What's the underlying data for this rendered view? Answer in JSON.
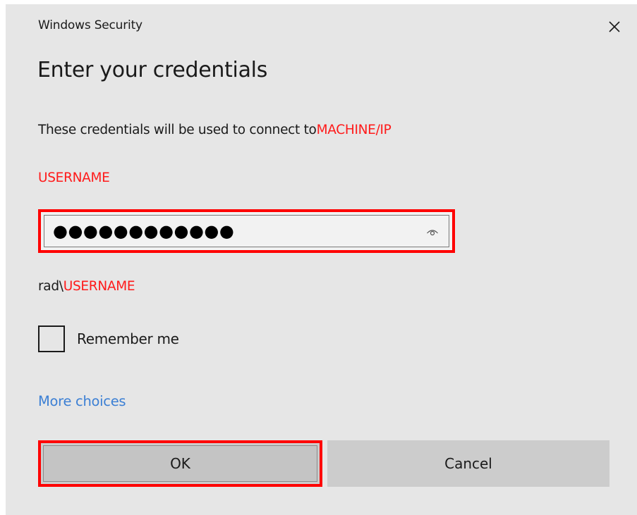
{
  "window": {
    "title": "Windows Security",
    "close_icon": "close-icon"
  },
  "dialog": {
    "heading": "Enter your credentials",
    "description_prefix": "These credentials will be used to connect to",
    "description_target": "MACHINE/IP"
  },
  "fields": {
    "username_label": "USERNAME",
    "password_value": "●●●●●●●●●●●●",
    "reveal_icon": "eye-icon"
  },
  "account": {
    "domain_prefix": "rad\\",
    "username": "USERNAME"
  },
  "remember": {
    "label": "Remember me",
    "checked": false
  },
  "links": {
    "more_choices": "More choices"
  },
  "buttons": {
    "ok_label": "OK",
    "cancel_label": "Cancel"
  },
  "colors": {
    "dialog_background": "#e6e6e6",
    "highlight_red": "#ff0000",
    "link_blue": "#3b7fd4",
    "button_gray": "#cccccc"
  }
}
